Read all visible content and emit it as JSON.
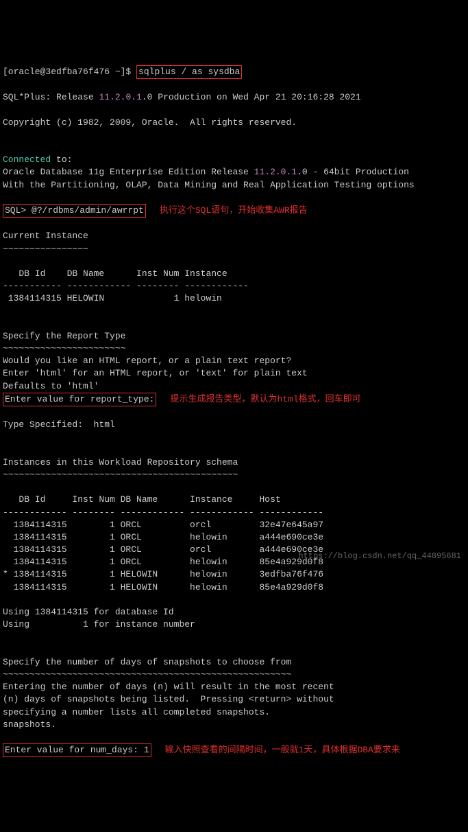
{
  "prompt1": {
    "prefix": "[oracle@3edfba76f476 ~]$ ",
    "cmd": "sqlplus / as sysdba"
  },
  "release_line": {
    "prefix": "SQL*Plus: Release ",
    "version": "11.2.0.1",
    "suffix": ".0 Production on Wed Apr 21 20:16:28 2021"
  },
  "copyright": "Copyright (c) 1982, 2009, Oracle.  All rights reserved.",
  "connected": {
    "word": "Connected",
    "suffix": " to:"
  },
  "db_release": {
    "prefix": "Oracle Database 11g Enterprise Edition Release ",
    "version": "11.2.0.1",
    "suffix": ".0 - 64bit Production"
  },
  "options_line": "With the Partitioning, OLAP, Data Mining and Real Application Testing options",
  "sql_prompt": {
    "prefix": "SQL> ",
    "cmd": "@?/rdbms/admin/awrrpt",
    "annotation": "执行这个SQL语句，开始收集AWR报告"
  },
  "current_instance": {
    "title": "Current Instance",
    "tilde": "~~~~~~~~~~~~~~~~",
    "header": "   DB Id    DB Name      Inst Num Instance",
    "divider": "----------- ------------ -------- ------------",
    "row": " 1384114315 HELOWIN             1 helowin"
  },
  "report_type": {
    "title": "Specify the Report Type",
    "tilde": "~~~~~~~~~~~~~~~~~~~~~~~",
    "line1": "Would you like an HTML report, or a plain text report?",
    "line2": "Enter 'html' for an HTML report, or 'text' for plain text",
    "line3": "Defaults to 'html'",
    "prompt": "Enter value for report_type:",
    "annotation": "提示生成报告类型，默认为html格式，回车即可"
  },
  "type_specified": "Type Specified:  html",
  "instances": {
    "title": "Instances in this Workload Repository schema",
    "tilde": "~~~~~~~~~~~~~~~~~~~~~~~~~~~~~~~~~~~~~~~~~~~~",
    "header": "   DB Id     Inst Num DB Name      Instance     Host",
    "divider": "------------ -------- ------------ ------------ ------------",
    "rows": [
      "  1384114315        1 ORCL         orcl         32e47e645a97",
      "  1384114315        1 ORCL         helowin      a444e690ce3e",
      "  1384114315        1 ORCL         orcl         a444e690ce3e",
      "  1384114315        1 ORCL         helowin      85e4a929d0f8",
      "* 1384114315        1 HELOWIN      helowin      3edfba76f476",
      "  1384114315        1 HELOWIN      helowin      85e4a929d0f8"
    ]
  },
  "using1": "Using 1384114315 for database Id",
  "using2": "Using          1 for instance number",
  "num_days": {
    "title": "Specify the number of days of snapshots to choose from",
    "tilde": "~~~~~~~~~~~~~~~~~~~~~~~~~~~~~~~~~~~~~~~~~~~~~~~~~~~~~~",
    "line1": "Entering the number of days (n) will result in the most recent",
    "line2": "(n) days of snapshots being listed.  Pressing <return> without",
    "line3": "specifying a number lists all completed snapshots.",
    "prompt": "Enter value for num_days: 1",
    "annotation": "输入快照查看的间隔时间，一般就1天，具体根据DBA要求来"
  },
  "watermark": "https://blog.csdn.net/qq_44895681"
}
